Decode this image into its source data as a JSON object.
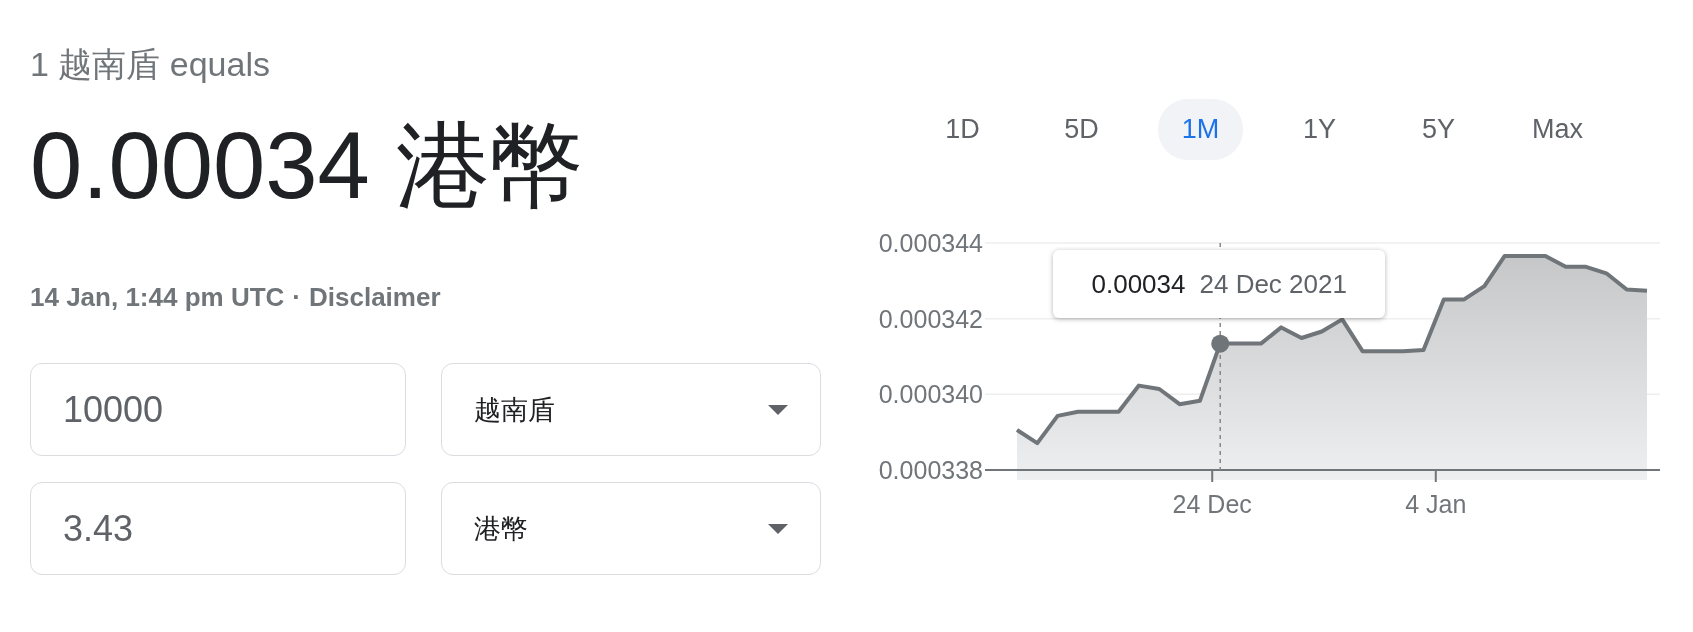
{
  "summary": {
    "label": "1 越南盾 equals",
    "result": "0.00034 港幣",
    "timestamp": "14 Jan, 1:44 pm UTC",
    "separator": "·",
    "disclaimer": "Disclaimer"
  },
  "converter": [
    {
      "amount": "10000",
      "currency": "越南盾"
    },
    {
      "amount": "3.43",
      "currency": "港幣"
    }
  ],
  "ranges": [
    {
      "label": "1D",
      "selected": false
    },
    {
      "label": "5D",
      "selected": false
    },
    {
      "label": "1M",
      "selected": true
    },
    {
      "label": "1Y",
      "selected": false
    },
    {
      "label": "5Y",
      "selected": false
    },
    {
      "label": "Max",
      "selected": false
    }
  ],
  "chart": {
    "tooltip": {
      "value": "0.00034",
      "date": "24 Dec 2021"
    },
    "chart_data": {
      "type": "area",
      "categories": [
        null,
        null,
        null,
        null,
        null,
        null,
        null,
        null,
        null,
        null,
        "24 Dec",
        null,
        null,
        null,
        null,
        null,
        null,
        null,
        null,
        null,
        null,
        "4 Jan",
        null,
        null,
        null,
        null,
        null,
        null,
        null,
        null,
        null,
        null
      ],
      "series": [
        {
          "color": "#70757a",
          "values": [
            0.00033906,
            0.00033871,
            0.00033943,
            0.00033954,
            0.00033954,
            0.00033954,
            0.00034023,
            0.00034014,
            0.00033974,
            0.00033983,
            0.00034134,
            0.00034134,
            0.00034134,
            0.00034177,
            0.00034149,
            0.00034166,
            0.00034198,
            0.00034114,
            0.00034114,
            0.00034114,
            0.00034117,
            0.00034251,
            0.00034251,
            0.00034286,
            0.00034366,
            0.00034366,
            0.00034366,
            0.00034337,
            0.00034337,
            0.0003432,
            0.00034277,
            0.00034274
          ]
        }
      ],
      "ylim": [
        0.000338,
        0.000344
      ],
      "yticks": [
        {
          "value": 0.000338,
          "label": "0.000338"
        },
        {
          "value": 0.00034,
          "label": "0.000340"
        },
        {
          "value": 0.000342,
          "label": "0.000342"
        },
        {
          "value": 0.000344,
          "label": "0.000344"
        }
      ],
      "annotations": [
        {
          "x": "24 Dec"
        }
      ]
    }
  }
}
